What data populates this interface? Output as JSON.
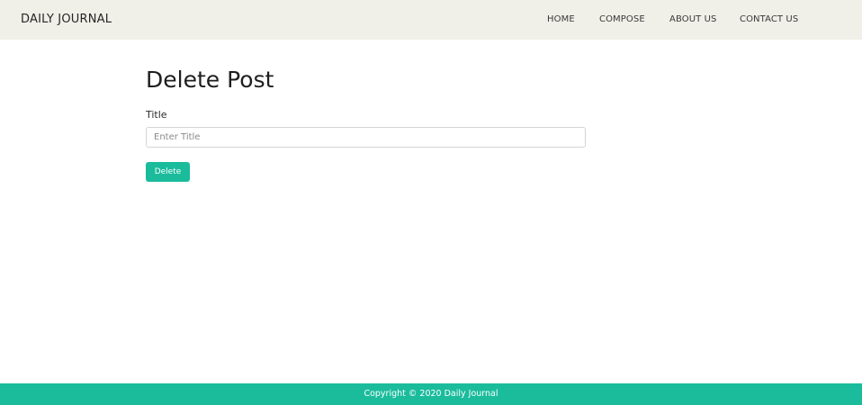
{
  "header": {
    "brand": "DAILY JOURNAL",
    "nav": {
      "home": "HOME",
      "compose": "COMPOSE",
      "about": "ABOUT US",
      "contact": "CONTACT US"
    }
  },
  "main": {
    "title": "Delete Post",
    "form": {
      "title_label": "Title",
      "title_value": "",
      "title_placeholder": "Enter Title",
      "submit_label": "Delete"
    }
  },
  "footer": {
    "text": "Copyright © 2020 Daily Journal"
  },
  "colors": {
    "navbar_bg": "#f0efe8",
    "accent": "#1abc9c",
    "text": "#222222"
  }
}
